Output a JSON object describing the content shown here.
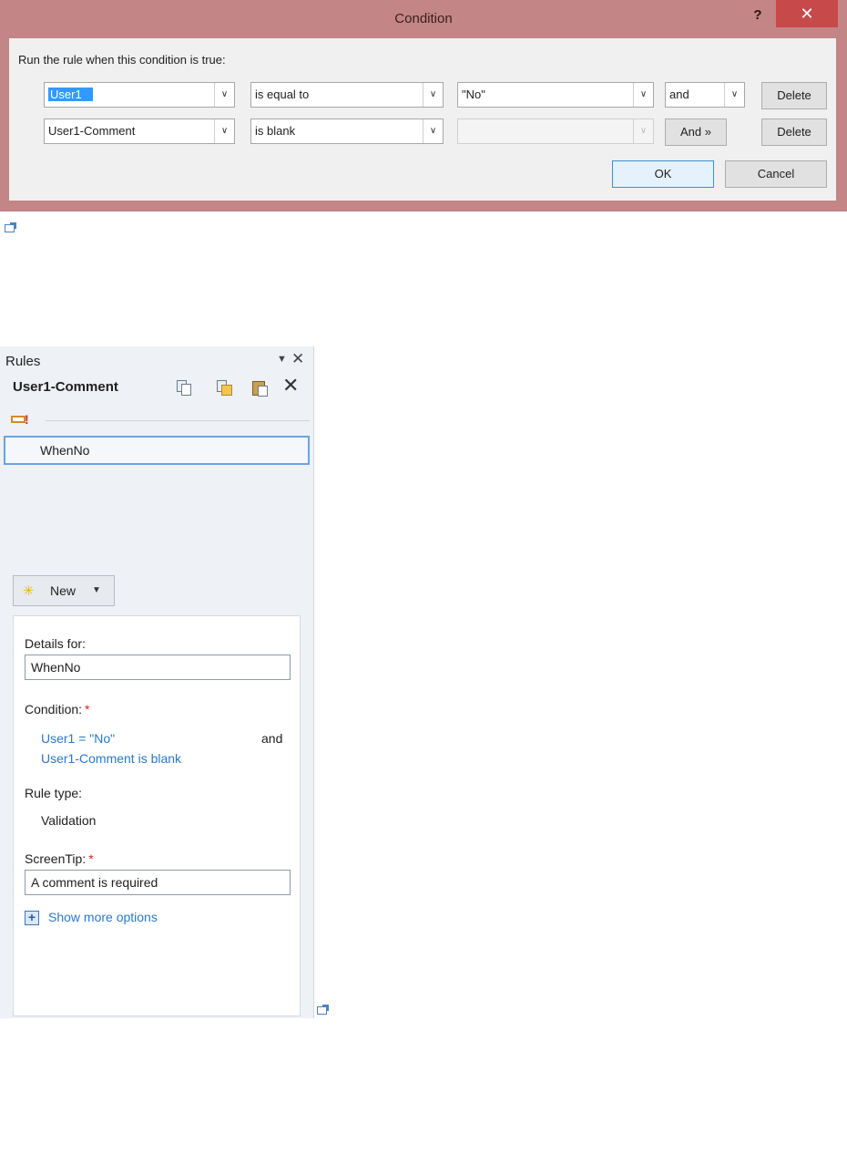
{
  "dialog": {
    "title": "Condition",
    "help_label": "?",
    "close_label": "✕",
    "prompt": "Run the rule when this condition is true:",
    "rows": [
      {
        "field": "User1",
        "operator": "is equal to",
        "value": "\"No\"",
        "connector": "and",
        "delete_label": "Delete"
      },
      {
        "field": "User1-Comment",
        "operator": "is blank",
        "value": "",
        "connector": "And »",
        "delete_label": "Delete"
      }
    ],
    "ok_label": "OK",
    "cancel_label": "Cancel"
  },
  "rules_pane": {
    "title": "Rules",
    "menu_icon": "▼",
    "close_icon": "✕",
    "field_name": "User1-Comment",
    "delete_icon": "✕",
    "rules": [
      {
        "name": "WhenNo"
      }
    ],
    "new_label": "New",
    "details": {
      "details_for_label": "Details for:",
      "rule_name": "WhenNo",
      "condition_label": "Condition:",
      "required_mark": "*",
      "condition_line1": "User1 = \"No\"",
      "condition_connector": "and",
      "condition_line2": "User1-Comment is blank",
      "rule_type_label": "Rule type:",
      "rule_type": "Validation",
      "screentip_label": "ScreenTip:",
      "screentip": "A comment is required",
      "show_more_label": "Show more options"
    }
  },
  "colors": {
    "dialog_frame": "#c38585",
    "close_button": "#c7494a",
    "selection": "#3399ff",
    "link": "#2878d0",
    "required": "#e02020"
  }
}
